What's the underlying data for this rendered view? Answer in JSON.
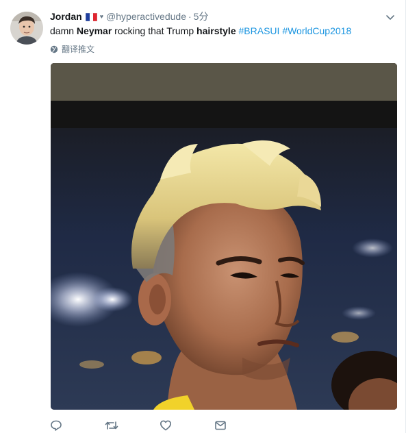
{
  "tweet": {
    "display_name": "Jordan",
    "handle": "@hyperactivedude",
    "separator": "·",
    "time": "5分",
    "text_parts": {
      "p1": "damn ",
      "b1": "Neymar",
      "p2": " rocking that Trump ",
      "b2": "hairstyle",
      "p3": " ",
      "tag1": "#BRASUI",
      "p4": " ",
      "tag2": "#WorldCup2018"
    },
    "translate_label": "翻译推文"
  },
  "icons": {
    "flag": "france-flag-icon",
    "badge": "heart-icon",
    "caret": "chevron-down-icon",
    "globe": "globe-icon",
    "reply": "reply-icon",
    "retweet": "retweet-icon",
    "like": "like-icon",
    "dm": "envelope-icon"
  },
  "colors": {
    "link": "#1b95e0",
    "secondary_text": "#657786",
    "primary_text": "#14171a"
  }
}
